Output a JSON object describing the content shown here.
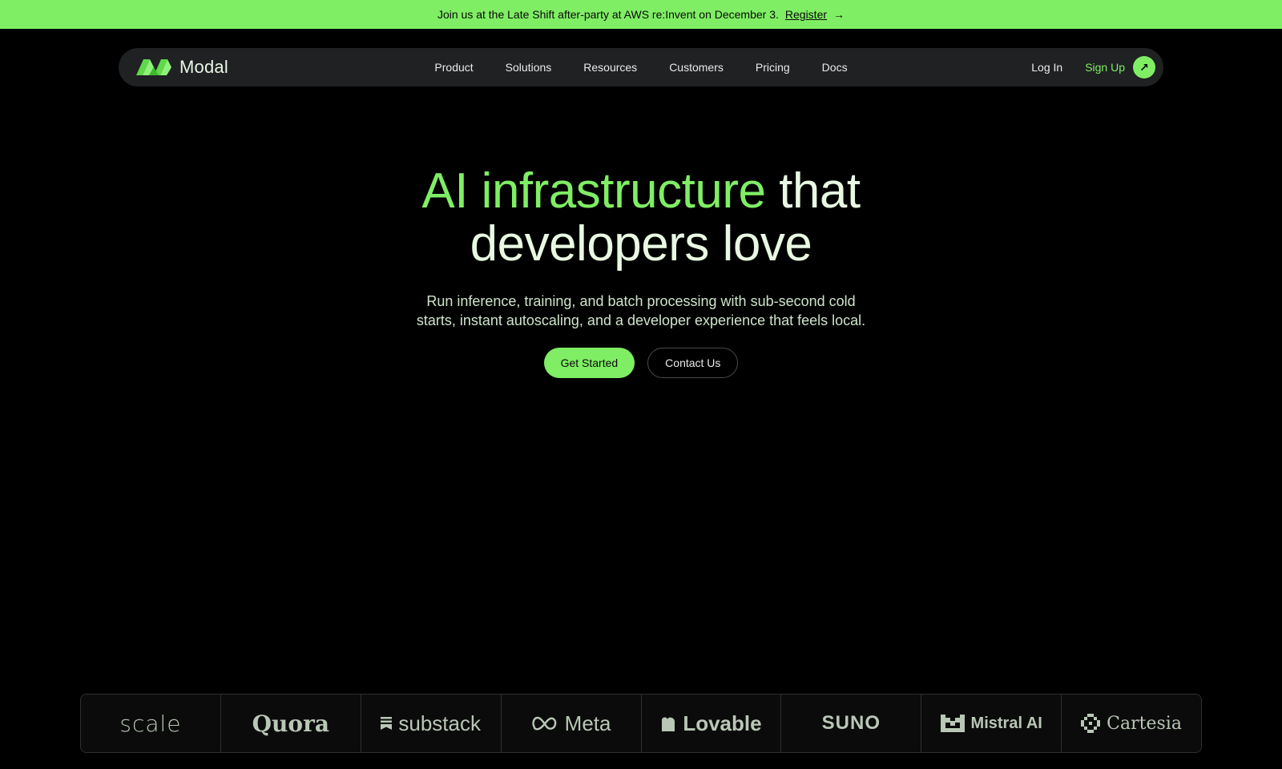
{
  "banner": {
    "text": "Join us at the Late Shift after-party at AWS re:Invent on December 3.",
    "link_label": "Register",
    "arrow": "→"
  },
  "nav": {
    "brand": "Modal",
    "links": [
      "Product",
      "Solutions",
      "Resources",
      "Customers",
      "Pricing",
      "Docs"
    ],
    "login": "Log In",
    "signup": "Sign Up",
    "signup_icon": "↗"
  },
  "hero": {
    "headline_accent": "AI infrastructure",
    "headline_rest_1": "that",
    "headline_line_2": "developers love",
    "subline_1": "Run inference, training, and batch processing with sub-second cold",
    "subline_2": "starts, instant autoscaling, and a developer experience that feels local.",
    "primary_cta": "Get Started",
    "secondary_cta": "Contact Us"
  },
  "customers": [
    "scale",
    "Quora",
    "substack",
    "Meta",
    "Lovable",
    "SUNO",
    "Mistral AI",
    "Cartesia"
  ],
  "colors": {
    "accent": "#7fee64",
    "background": "#000000",
    "nav_bg": "#1f2123"
  }
}
